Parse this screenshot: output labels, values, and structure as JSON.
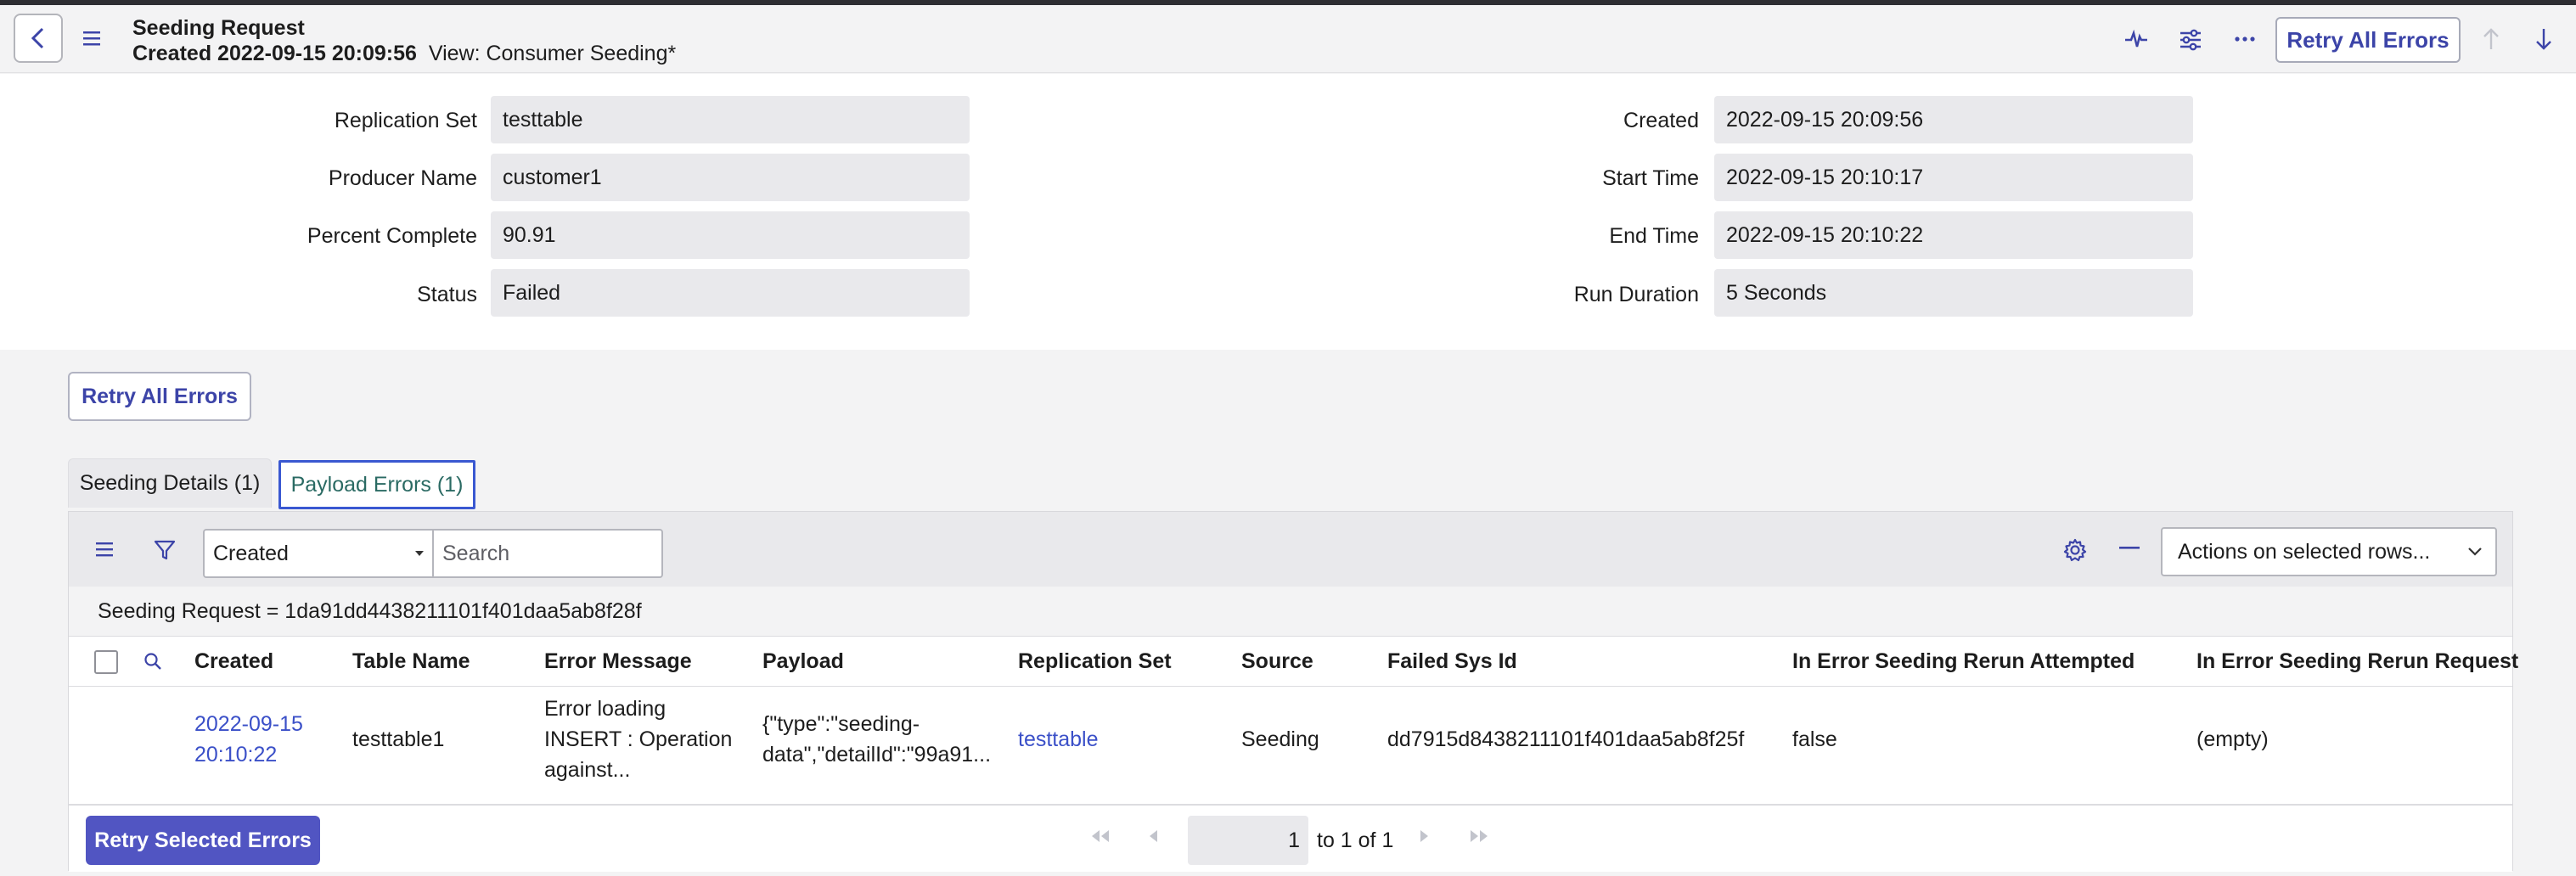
{
  "header": {
    "title": "Seeding Request",
    "created_prefix": "Created 2022-09-15 20:09:56",
    "view_label": "View: Consumer Seeding*",
    "retry_all_label": "Retry All Errors"
  },
  "form": {
    "left": [
      {
        "label": "Replication Set",
        "value": "testtable"
      },
      {
        "label": "Producer Name",
        "value": "customer1"
      },
      {
        "label": "Percent Complete",
        "value": "90.91"
      },
      {
        "label": "Status",
        "value": "Failed"
      }
    ],
    "right": [
      {
        "label": "Created",
        "value": "2022-09-15 20:09:56"
      },
      {
        "label": "Start Time",
        "value": "2022-09-15 20:10:17"
      },
      {
        "label": "End Time",
        "value": "2022-09-15 20:10:22"
      },
      {
        "label": "Run Duration",
        "value": "5 Seconds"
      }
    ]
  },
  "retry_all_label": "Retry All Errors",
  "tabs": [
    {
      "label": "Seeding Details (1)",
      "active": false
    },
    {
      "label": "Payload Errors (1)",
      "active": true
    }
  ],
  "list": {
    "filter_field": "Created",
    "search_placeholder": "Search",
    "actions_label": "Actions on selected rows...",
    "breadcrumb": "Seeding Request = 1da91dd4438211101f401daa5ab8f28f",
    "columns": [
      "Created",
      "Table Name",
      "Error Message",
      "Payload",
      "Replication Set",
      "Source",
      "Failed Sys Id",
      "In Error Seeding Rerun Attempted",
      "In Error Seeding Rerun Request"
    ],
    "rows": [
      {
        "created_line1": "2022-09-15",
        "created_line2": "20:10:22",
        "table_name": "testtable1",
        "error_line1": "Error loading",
        "error_line2": "INSERT : Operation",
        "error_line3": "against...",
        "payload_line1": "{\"type\":\"seeding-",
        "payload_line2": "data\",\"detailId\":\"99a91...",
        "replication_set": "testtable",
        "source": "Seeding",
        "failed_sys_id": "dd7915d8438211101f401daa5ab8f25f",
        "rerun_attempted": "false",
        "rerun_request": "(empty)"
      }
    ],
    "retry_selected_label": "Retry Selected Errors",
    "pager": {
      "page": "1",
      "of_text": "to 1 of 1"
    }
  },
  "colors": {
    "accent": "#3c44a8",
    "primary_button": "#5155c2",
    "link": "#3b50c8",
    "active_tab_border": "#3a58d1"
  }
}
